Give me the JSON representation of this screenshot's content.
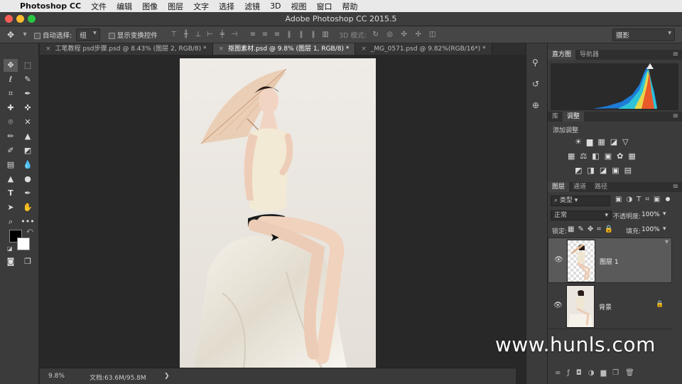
{
  "menubar": {
    "app": "Photoshop CC",
    "items": [
      "文件",
      "编辑",
      "图像",
      "图层",
      "文字",
      "选择",
      "滤镜",
      "3D",
      "视图",
      "窗口",
      "帮助"
    ]
  },
  "window": {
    "title": "Adobe Photoshop CC 2015.5"
  },
  "options": {
    "auto_select_label": "自动选择:",
    "auto_select_value": "组",
    "show_transform_label": "显示变换控件",
    "mode_3d_label": "3D 模式:",
    "workspace": "摄影"
  },
  "tabs": [
    {
      "label": "工笔教程 psd步骤.psd @ 8.43% (图层 2, RGB/8) *"
    },
    {
      "label": "抠图素材.psd @ 9.8% (图层 1, RGB/8) *"
    },
    {
      "label": "_MG_0571.psd @ 9.82%(RGB/16*) *"
    }
  ],
  "status": {
    "zoom": "9.8%",
    "doc": "文档:63.6M/95.8M",
    "arrow": "❯"
  },
  "panels": {
    "histogram_tab": "直方图",
    "navigator_tab": "导航器",
    "library_tab": "库",
    "adjust_tab": "调整",
    "add_adjust": "添加调整",
    "layers_tab": "图层",
    "channels_tab": "通道",
    "paths_tab": "路径",
    "kind_filter": "类型",
    "blend_mode": "正常",
    "opacity_label": "不透明度:",
    "opacity_value": "100%",
    "lock_label": "锁定:",
    "fill_label": "填充:",
    "fill_value": "100%",
    "layers": [
      {
        "name": "图层 1",
        "selected": true
      },
      {
        "name": "背景",
        "selected": false
      }
    ]
  },
  "watermark": "www.hunls.com",
  "colors": {
    "accent_tab": "#4a4a4a",
    "photo_bg": "#eae6e0"
  }
}
